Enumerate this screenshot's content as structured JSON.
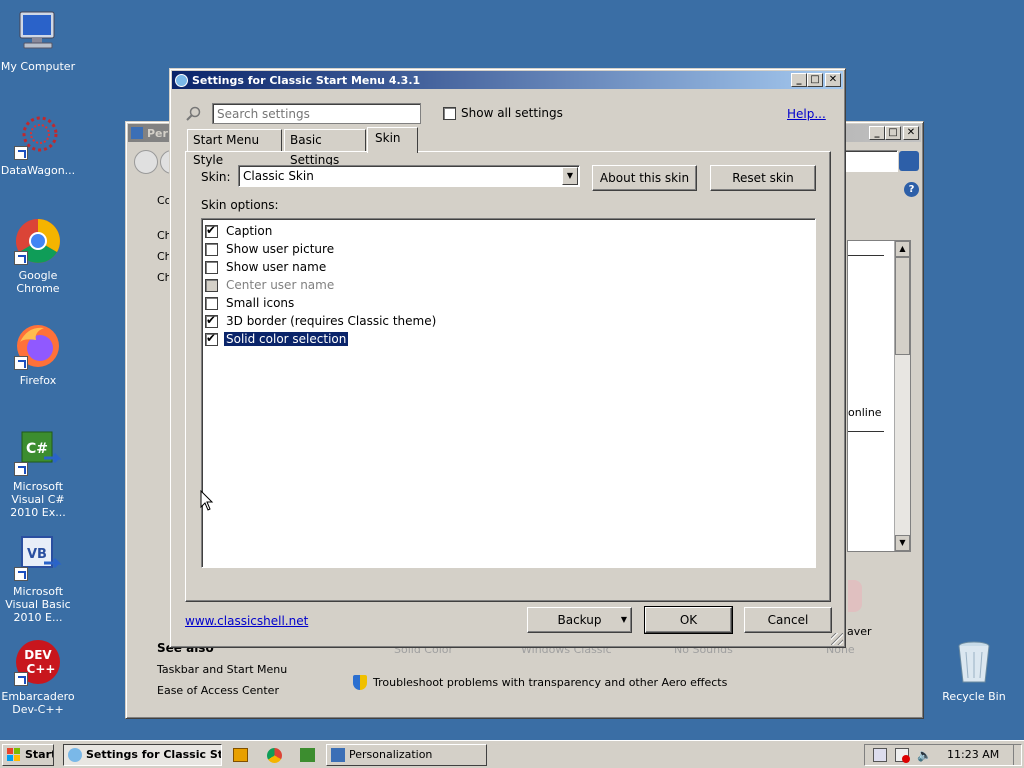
{
  "desktop": {
    "icons": [
      {
        "label": "My Computer"
      },
      {
        "label": "DataWagon..."
      },
      {
        "label": "Google Chrome"
      },
      {
        "label": "Firefox"
      },
      {
        "label": "Microsoft Visual C# 2010 Ex..."
      },
      {
        "label": "Microsoft Visual Basic 2010 E..."
      },
      {
        "label": "Embarcadero Dev-C++"
      },
      {
        "label": "Recycle Bin"
      }
    ]
  },
  "background_window": {
    "title": "Per",
    "left_items": [
      "Co",
      "Ch",
      "Ch",
      "Ch"
    ],
    "right_text": "online",
    "saver_text": "aver",
    "see_also_title": "See also",
    "see_also_links": [
      "Taskbar and Start Menu",
      "Ease of Access Center"
    ],
    "troubleshoot_link": "Troubleshoot problems with transparency and other Aero effects",
    "theme_captions": [
      "Solid Color",
      "Windows Classic",
      "No Sounds",
      "None"
    ]
  },
  "dialog": {
    "title": "Settings for Classic Start Menu 4.3.1",
    "search_placeholder": "Search settings",
    "show_all_label": "Show all settings",
    "help_link": "Help...",
    "tabs": [
      {
        "label": "Start Menu Style"
      },
      {
        "label": "Basic Settings"
      },
      {
        "label": "Skin"
      }
    ],
    "skin_label": "Skin:",
    "skin_value": "Classic Skin",
    "about_button": "About this skin",
    "reset_button": "Reset skin",
    "options_label": "Skin options:",
    "options": [
      {
        "label": "Caption",
        "checked": true,
        "disabled": false
      },
      {
        "label": "Show user picture",
        "checked": false,
        "disabled": false
      },
      {
        "label": "Show user name",
        "checked": false,
        "disabled": false
      },
      {
        "label": "Center user name",
        "checked": false,
        "disabled": true
      },
      {
        "label": "Small icons",
        "checked": false,
        "disabled": false
      },
      {
        "label": "3D border (requires Classic theme)",
        "checked": true,
        "disabled": false
      },
      {
        "label": "Solid color selection",
        "checked": true,
        "disabled": false,
        "selected": true
      }
    ],
    "website_link": "www.classicshell.net",
    "backup_button": "Backup",
    "ok_button": "OK",
    "cancel_button": "Cancel"
  },
  "taskbar": {
    "start_label": "Start",
    "tasks": [
      {
        "label": "Settings for Classic St..."
      },
      {
        "label": "Personalization"
      }
    ],
    "clock": "11:23 AM"
  },
  "colors": {
    "desktop": "#3a6ea5",
    "title_active": "#0a246a",
    "selection": "#0a246a",
    "link": "#0000cc"
  }
}
